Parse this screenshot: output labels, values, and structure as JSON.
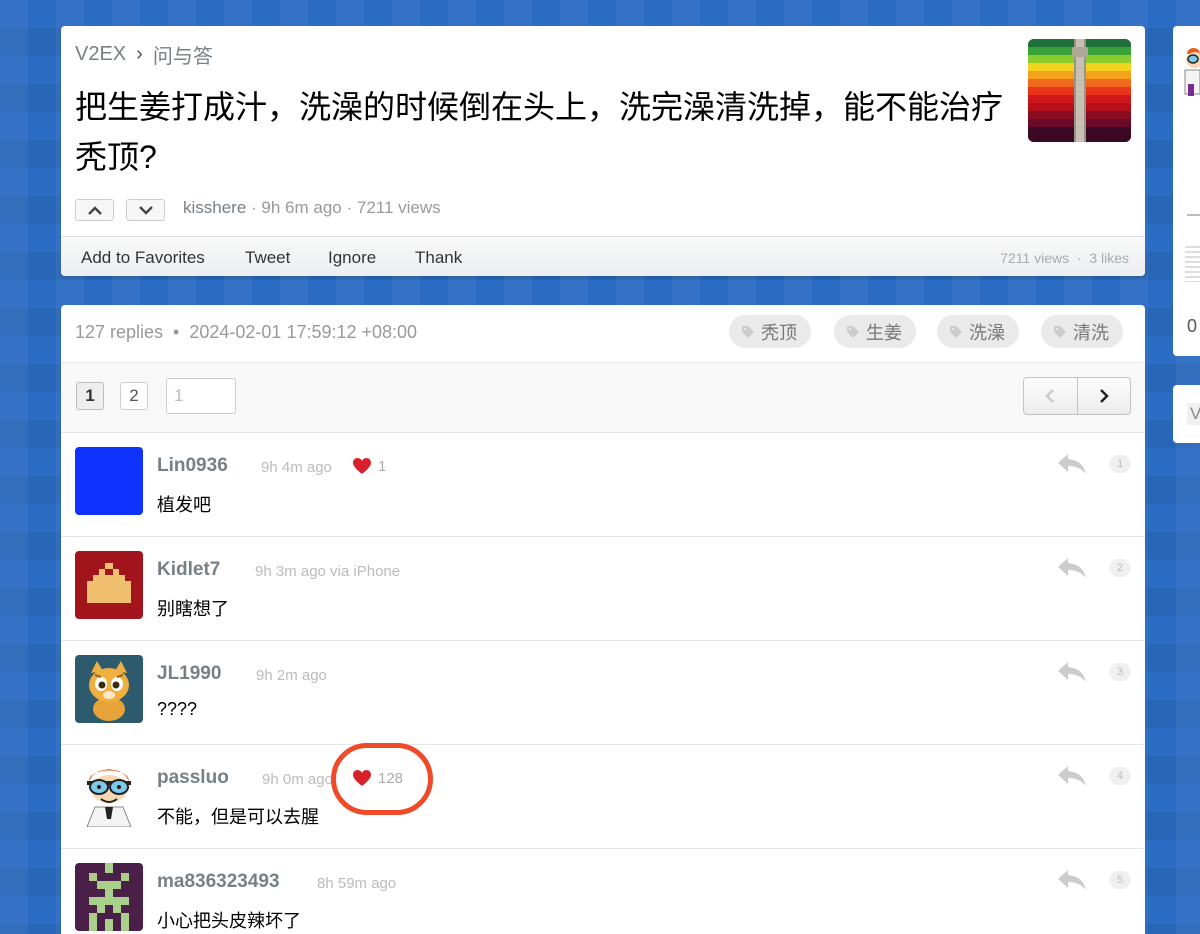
{
  "topic": {
    "breadcrumb_site": "V2EX",
    "breadcrumb_sep": "›",
    "breadcrumb_node": "问与答",
    "title": "把生姜打成汁，洗澡的时候倒在头上，洗完澡清洗掉，能不能治疗秃顶?",
    "author": "kisshere",
    "meta_rest": " · 9h 6m ago · 7211 views",
    "actions": {
      "favorite": "Add to Favorites",
      "tweet": "Tweet",
      "ignore": "Ignore",
      "thank": "Thank"
    },
    "stats": "7211 views  ·  3 likes"
  },
  "replies_header": {
    "summary": "127 replies  •  2024-02-01 17:59:12 +08:00",
    "tags": [
      "秃顶",
      "生姜",
      "洗澡",
      "清洗"
    ]
  },
  "pagination": {
    "pages": [
      "1",
      "2"
    ],
    "current": "1",
    "jump_value": "1"
  },
  "replies": [
    {
      "user": "Lin0936",
      "time": "9h 4m ago",
      "likes": "1",
      "content": "植发吧",
      "floor": "1"
    },
    {
      "user": "Kidlet7",
      "time": "9h 3m ago via iPhone",
      "likes": "",
      "content": "别瞎想了",
      "floor": "2"
    },
    {
      "user": "JL1990",
      "time": "9h 2m ago",
      "likes": "",
      "content": "????",
      "floor": "3"
    },
    {
      "user": "passluo",
      "time": "9h 0m ago",
      "likes": "128",
      "content": "不能，但是可以去腥",
      "floor": "4"
    },
    {
      "user": "ma836323493",
      "time": "8h 59m ago",
      "likes": "",
      "content": "小心把头皮辣坏了",
      "floor": "5"
    }
  ],
  "sidebar": {
    "stat_digit": "0",
    "letter": "V"
  },
  "colors": {
    "accent_red": "#ef4a2a",
    "username_gray": "#778087",
    "background_blue": "#2b6cc4"
  }
}
